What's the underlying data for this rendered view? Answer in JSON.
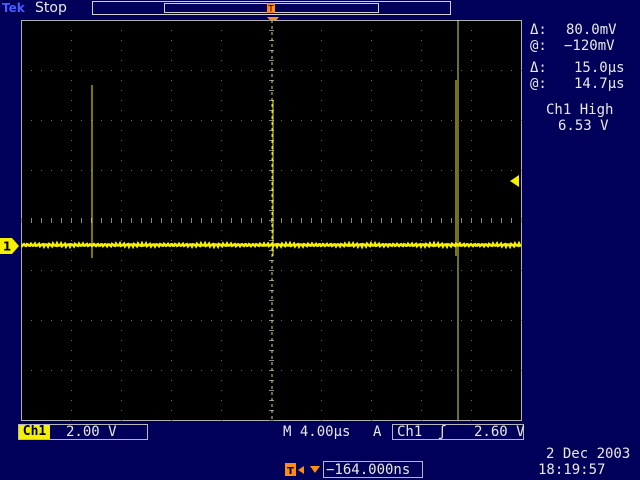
{
  "header": {
    "brand": "Tek",
    "run_state": "Stop",
    "trigger_mini_marker": "T"
  },
  "cursors": {
    "voltage_delta_symbol": "Δ:",
    "voltage_delta": "80.0mV",
    "voltage_at_symbol": "@:",
    "voltage_at": "−120mV",
    "time_delta_symbol": "Δ:",
    "time_delta": "15.0µs",
    "time_at_symbol": "@:",
    "time_at": "14.7µs"
  },
  "measurement": {
    "label": "Ch1 High",
    "value": "6.53 V"
  },
  "channel": {
    "label": "Ch1",
    "scale": "2.00 V",
    "marker": "1",
    "color": "#f4f000"
  },
  "timebase": {
    "label": "M 4.00µs"
  },
  "trigger": {
    "mode": "A",
    "source": "Ch1",
    "slope_symbol": "ʃ",
    "level": "2.60 V",
    "marker": "T",
    "color": "#ff8c1a"
  },
  "position": {
    "value": "−164.000ns"
  },
  "datetime": {
    "date": "2 Dec 2003",
    "time": "18:19:57"
  }
}
